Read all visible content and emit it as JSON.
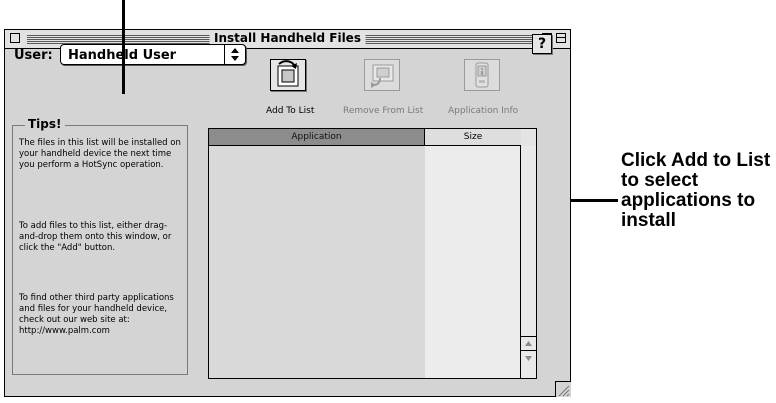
{
  "window": {
    "title": "Install Handheld Files"
  },
  "user": {
    "label": "User:",
    "selected": "Handheld User"
  },
  "toolbar": {
    "add_to_list": "Add To List",
    "remove_from_list": "Remove From List",
    "application_info": "Application Info",
    "help": "?"
  },
  "tips": {
    "title": "Tips!",
    "paragraphs": [
      "The files in this list will be installed on your handheld device the next time you perform a HotSync operation.",
      "To add files to this list, either drag-and-drop them onto this window, or click the \"Add\" button.",
      "To find other third party applications and files for your handheld device, check out our web site at: http://www.palm.com"
    ]
  },
  "list": {
    "columns": [
      "Application",
      "Size"
    ]
  },
  "callout": {
    "text": "Click Add to List to select applications to install"
  },
  "icons": {
    "add": "add-to-list-icon",
    "remove": "remove-from-list-icon",
    "info": "application-info-icon"
  }
}
